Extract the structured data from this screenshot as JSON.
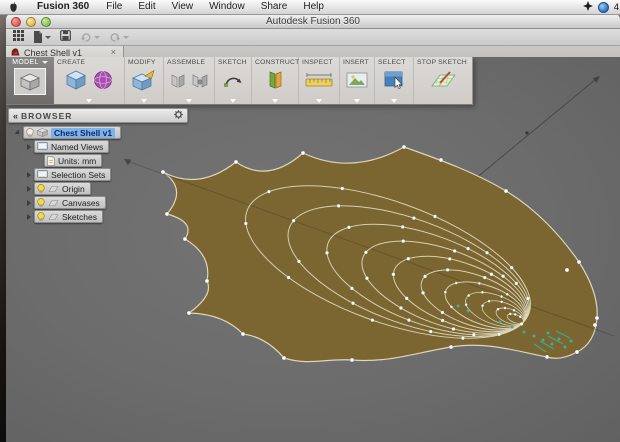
{
  "menubar": {
    "app_name": "Fusion 360",
    "items": [
      "File",
      "Edit",
      "View",
      "Window",
      "Share",
      "Help"
    ],
    "status_icons": [
      "spaces-icon",
      "sync-globe-icon"
    ],
    "status_count": "4"
  },
  "window": {
    "title": "Autodesk Fusion 360"
  },
  "quickbar": {
    "icons": [
      "data-panel-grid-icon",
      "file-icon",
      "save-icon",
      "undo-icon",
      "redo-icon"
    ]
  },
  "tab": {
    "title": "Chest Shell v1",
    "close_glyph": "×"
  },
  "ribbon": {
    "model_label": "MODEL",
    "sections": [
      {
        "label": "CREATE"
      },
      {
        "label": "MODIFY"
      },
      {
        "label": "ASSEMBLE"
      },
      {
        "label": "SKETCH"
      },
      {
        "label": "CONSTRUCT"
      },
      {
        "label": "INSPECT"
      },
      {
        "label": "INSERT"
      },
      {
        "label": "SELECT"
      },
      {
        "label": "STOP SKETCH"
      }
    ]
  },
  "browser": {
    "header_label": "BROWSER",
    "collapse_glyph": "«",
    "items": [
      {
        "label": "Chest Shell v1",
        "selected": true
      },
      {
        "label": "Named Views",
        "selected": false
      },
      {
        "label": "Units: mm",
        "selected": false
      },
      {
        "label": "Selection Sets",
        "selected": false
      },
      {
        "label": "Origin",
        "selected": false
      },
      {
        "label": "Canvases",
        "selected": false
      },
      {
        "label": "Sketches",
        "selected": false
      }
    ]
  },
  "colors": {
    "selection_highlight": "#7fb2e8",
    "viewport_background": "#6c6c6c",
    "shape_fill": "#7b6530",
    "contour_stroke": "#ddd6ba",
    "control_point": "#ffffff",
    "selected_point": "#39b09a",
    "axis_line": "#3a3a3a"
  }
}
